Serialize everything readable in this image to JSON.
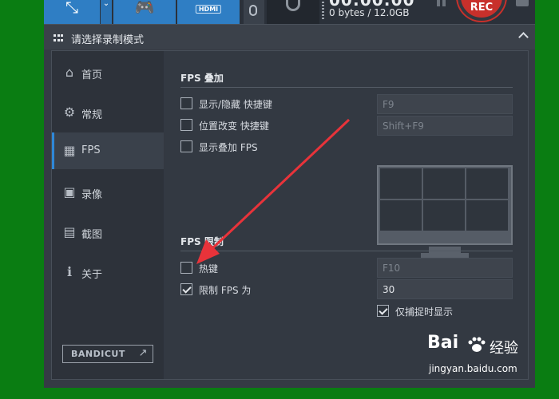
{
  "toolbar": {
    "hdmi_label": "HDMI",
    "timer": "00:00:00",
    "bytes": "0 bytes / 12.0GB",
    "rec_label": "REC"
  },
  "window": {
    "title": "请选择录制模式"
  },
  "sidebar": {
    "items": [
      {
        "label": "首页",
        "icon": "home-icon"
      },
      {
        "label": "常规",
        "icon": "gear-icon"
      },
      {
        "label": "FPS",
        "icon": "fps-icon",
        "active": true
      },
      {
        "label": "录像",
        "icon": "video-icon"
      },
      {
        "label": "截图",
        "icon": "image-icon"
      },
      {
        "label": "关于",
        "icon": "info-icon"
      }
    ],
    "bandicut_label": "BANDICUT",
    "bandicut_arrow": "↗"
  },
  "overlay": {
    "title": "FPS 叠加",
    "show_hide_label": "显示/隐藏 快捷键",
    "show_hide_key": "F9",
    "position_label": "位置改变 快捷键",
    "position_key": "Shift+F9",
    "show_overlay_label": "显示叠加 FPS"
  },
  "limit": {
    "title": "FPS 限制",
    "hotkey_label": "热键",
    "hotkey_key": "F10",
    "limit_label": "限制 FPS 为",
    "limit_value": "30",
    "capture_only_label": "仅捕捉时显示"
  },
  "watermark": {
    "logo": "Bai",
    "cn": "经验",
    "url": "jingyan.baidu.com"
  },
  "colors": {
    "accent": "#2f7ec4",
    "rec": "#c8302b",
    "arrow": "#e8333a",
    "background": "#0a7d12"
  }
}
